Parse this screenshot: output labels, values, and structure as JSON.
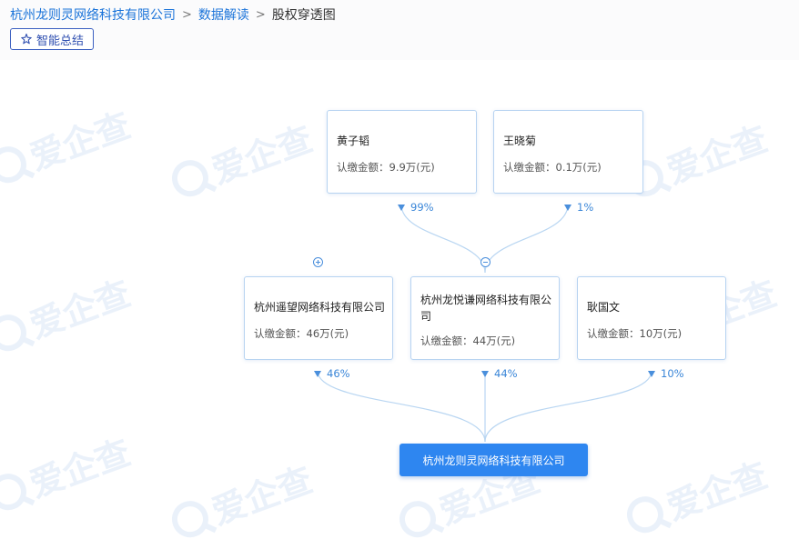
{
  "breadcrumb": {
    "company": "杭州龙则灵网络科技有限公司",
    "section": "数据解读",
    "current": "股权穿透图",
    "separator": ">"
  },
  "summary_button": {
    "label": "智能总结",
    "icon": "sparkle-icon"
  },
  "watermark": {
    "text": "爱企查",
    "color": "#3a7bd5"
  },
  "amount_prefix": "认缴金额：",
  "top_shareholders": [
    {
      "name": "黄子韬",
      "amount": "认缴金额：9.9万(元)",
      "percent": "99%"
    },
    {
      "name": "王晓菊",
      "amount": "认缴金额：0.1万(元)",
      "percent": "1%"
    }
  ],
  "direct_shareholders": [
    {
      "name": "杭州遥望网络科技有限公司",
      "amount": "认缴金额：46万(元)",
      "percent": "46%",
      "toggle": "+"
    },
    {
      "name": "杭州龙悦谦网络科技有限公司",
      "amount": "认缴金额：44万(元)",
      "percent": "44%",
      "toggle": "−"
    },
    {
      "name": "耿国文",
      "amount": "认缴金额：10万(元)",
      "percent": "10%"
    }
  ],
  "root": {
    "name": "杭州龙则灵网络科技有限公司"
  },
  "colors": {
    "accent": "#2e86f0",
    "link": "#1a73d9",
    "edge": "#b9d6f2",
    "percent": "#3a86d8",
    "node_border": "#b7d3f1"
  }
}
